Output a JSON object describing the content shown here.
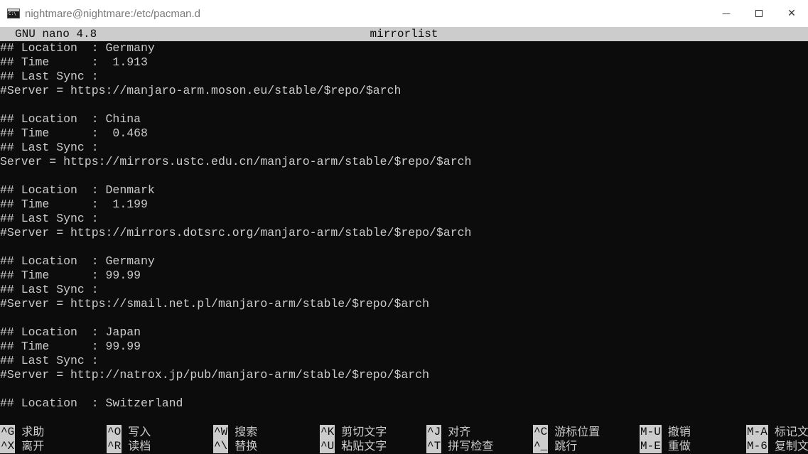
{
  "window": {
    "title": "nightmare@nightmare:/etc/pacman.d",
    "minimize_glyph": "—",
    "maximize_glyph": "",
    "close_glyph": "✕"
  },
  "nano": {
    "version": "GNU nano 4.8",
    "filename": "mirrorlist"
  },
  "lines": [
    "## Location  : Germany",
    "## Time      :  1.913",
    "## Last Sync :",
    "#Server = https://manjaro-arm.moson.eu/stable/$repo/$arch",
    "",
    "## Location  : China",
    "## Time      :  0.468",
    "## Last Sync :",
    "Server = https://mirrors.ustc.edu.cn/manjaro-arm/stable/$repo/$arch",
    "",
    "## Location  : Denmark",
    "## Time      :  1.199",
    "## Last Sync :",
    "#Server = https://mirrors.dotsrc.org/manjaro-arm/stable/$repo/$arch",
    "",
    "## Location  : Germany",
    "## Time      : 99.99",
    "## Last Sync :",
    "#Server = https://smail.net.pl/manjaro-arm/stable/$repo/$arch",
    "",
    "## Location  : Japan",
    "## Time      : 99.99",
    "## Last Sync :",
    "#Server = http://natrox.jp/pub/manjaro-arm/stable/$repo/$arch",
    "",
    "## Location  : Switzerland",
    ""
  ],
  "shortcuts": [
    {
      "key": "^G",
      "label": "求助"
    },
    {
      "key": "^O",
      "label": "写入"
    },
    {
      "key": "^W",
      "label": "搜索"
    },
    {
      "key": "^K",
      "label": "剪切文字"
    },
    {
      "key": "^J",
      "label": "对齐"
    },
    {
      "key": "^C",
      "label": "游标位置"
    },
    {
      "key": "M-U",
      "label": "撤销"
    },
    {
      "key": "M-A",
      "label": "标记文"
    },
    {
      "key": "^X",
      "label": "离开"
    },
    {
      "key": "^R",
      "label": "读档"
    },
    {
      "key": "^\\",
      "label": "替换"
    },
    {
      "key": "^U",
      "label": "粘贴文字"
    },
    {
      "key": "^T",
      "label": "拼写检查"
    },
    {
      "key": "^_",
      "label": "跳行"
    },
    {
      "key": "M-E",
      "label": "重做"
    },
    {
      "key": "M-6",
      "label": "复制文"
    }
  ],
  "colors": {
    "terminal_bg": "#0c0c0c",
    "terminal_fg": "#cccccc",
    "titlebar_bg": "#ffffff",
    "title_text": "#7a7a7a"
  }
}
